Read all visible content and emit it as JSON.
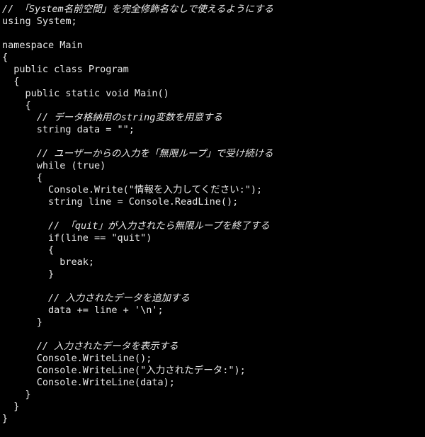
{
  "editor": {
    "language": "csharp",
    "background_color": "#000000",
    "text_color": "#e8e8e8",
    "comment_style": "italic",
    "font_size_px": 13.5,
    "line_height_px": 17,
    "indent_unit": "  ",
    "total_lines": 36
  },
  "code": {
    "lines": [
      {
        "text": "// 「System名前空間」を完全修飾名なしで使えるようにする",
        "kind": "comment"
      },
      {
        "text": "using System;",
        "kind": "code"
      },
      {
        "text": "",
        "kind": "blank"
      },
      {
        "text": "namespace Main",
        "kind": "code"
      },
      {
        "text": "{",
        "kind": "code"
      },
      {
        "text": "  public class Program",
        "kind": "code"
      },
      {
        "text": "  {",
        "kind": "code"
      },
      {
        "text": "    public static void Main()",
        "kind": "code"
      },
      {
        "text": "    {",
        "kind": "code"
      },
      {
        "text": "      // データ格納用のstring変数を用意する",
        "kind": "comment"
      },
      {
        "text": "      string data = \"\";",
        "kind": "code"
      },
      {
        "text": "",
        "kind": "blank"
      },
      {
        "text": "      // ユーザーからの入力を「無限ループ」で受け続ける",
        "kind": "comment"
      },
      {
        "text": "      while (true)",
        "kind": "code"
      },
      {
        "text": "      {",
        "kind": "code"
      },
      {
        "text": "        Console.Write(\"情報を入力してください:\");",
        "kind": "code"
      },
      {
        "text": "        string line = Console.ReadLine();",
        "kind": "code"
      },
      {
        "text": "",
        "kind": "blank"
      },
      {
        "text": "        // 「quit」が入力されたら無限ループを終了する",
        "kind": "comment"
      },
      {
        "text": "        if(line == \"quit\")",
        "kind": "code"
      },
      {
        "text": "        {",
        "kind": "code"
      },
      {
        "text": "          break;",
        "kind": "code"
      },
      {
        "text": "        }",
        "kind": "code"
      },
      {
        "text": "",
        "kind": "blank"
      },
      {
        "text": "        // 入力されたデータを追加する",
        "kind": "comment"
      },
      {
        "text": "        data += line + '\\n';",
        "kind": "code"
      },
      {
        "text": "      }",
        "kind": "code"
      },
      {
        "text": "",
        "kind": "blank"
      },
      {
        "text": "      // 入力されたデータを表示する",
        "kind": "comment"
      },
      {
        "text": "      Console.WriteLine();",
        "kind": "code"
      },
      {
        "text": "      Console.WriteLine(\"入力されたデータ:\");",
        "kind": "code"
      },
      {
        "text": "      Console.WriteLine(data);",
        "kind": "code"
      },
      {
        "text": "    }",
        "kind": "code"
      },
      {
        "text": "  }",
        "kind": "code"
      },
      {
        "text": "}",
        "kind": "code"
      },
      {
        "text": "",
        "kind": "blank"
      }
    ]
  }
}
